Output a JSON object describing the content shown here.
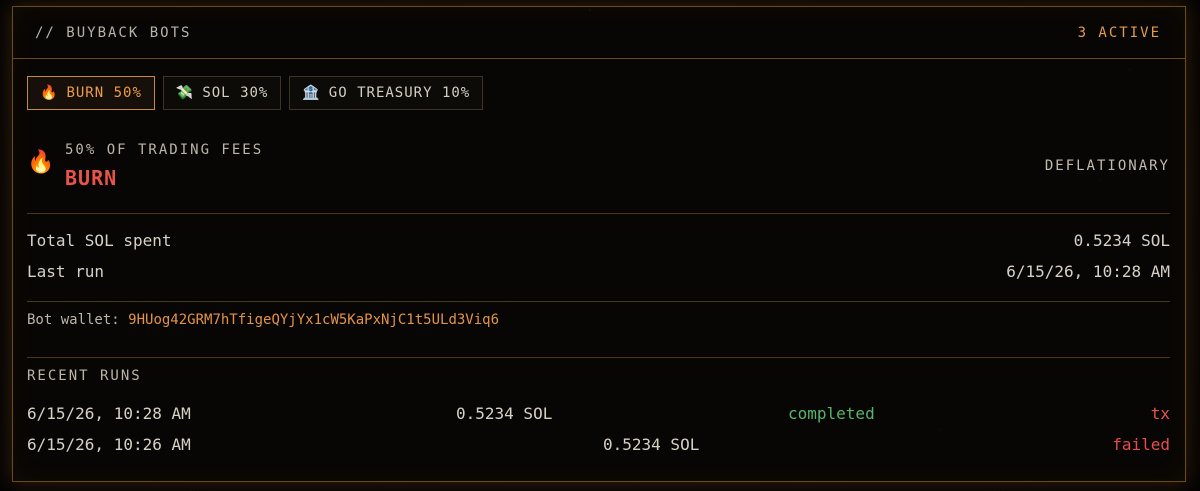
{
  "header": {
    "title": "// BUYBACK BOTS",
    "count": "3 ACTIVE"
  },
  "tabs": [
    {
      "icon": "🔥",
      "label": "BURN",
      "pct": "50%",
      "active": true
    },
    {
      "icon": "💸",
      "label": "SOL",
      "pct": "30%",
      "active": false
    },
    {
      "icon": "🏦",
      "label": "GO TREASURY",
      "pct": "10%",
      "active": false
    }
  ],
  "bot": {
    "icon": "🔥",
    "subtitle": "50% OF TRADING FEES",
    "name": "BURN",
    "type": "DEFLATIONARY"
  },
  "stats": {
    "total_label": "Total SOL spent",
    "total_value": "0.5234 SOL",
    "last_label": "Last run",
    "last_value": "6/15/26, 10:28 AM"
  },
  "wallet": {
    "label": "Bot wallet:",
    "address": "9HUog42GRM7hTfigeQYjYx1cW5KaPxNjC1t5ULd3Viq6"
  },
  "recent": {
    "title": "RECENT RUNS",
    "runs": [
      {
        "date": "6/15/26, 10:28 AM",
        "amount": "0.5234 SOL",
        "status": "completed",
        "link": "tx"
      },
      {
        "date": "6/15/26, 10:26 AM",
        "amount": "0.5234 SOL",
        "status": "failed"
      }
    ]
  },
  "colors": {
    "accent": "#e49a4a",
    "danger": "#e34d4a",
    "success": "#58b46a",
    "border": "#6b4a1c"
  }
}
